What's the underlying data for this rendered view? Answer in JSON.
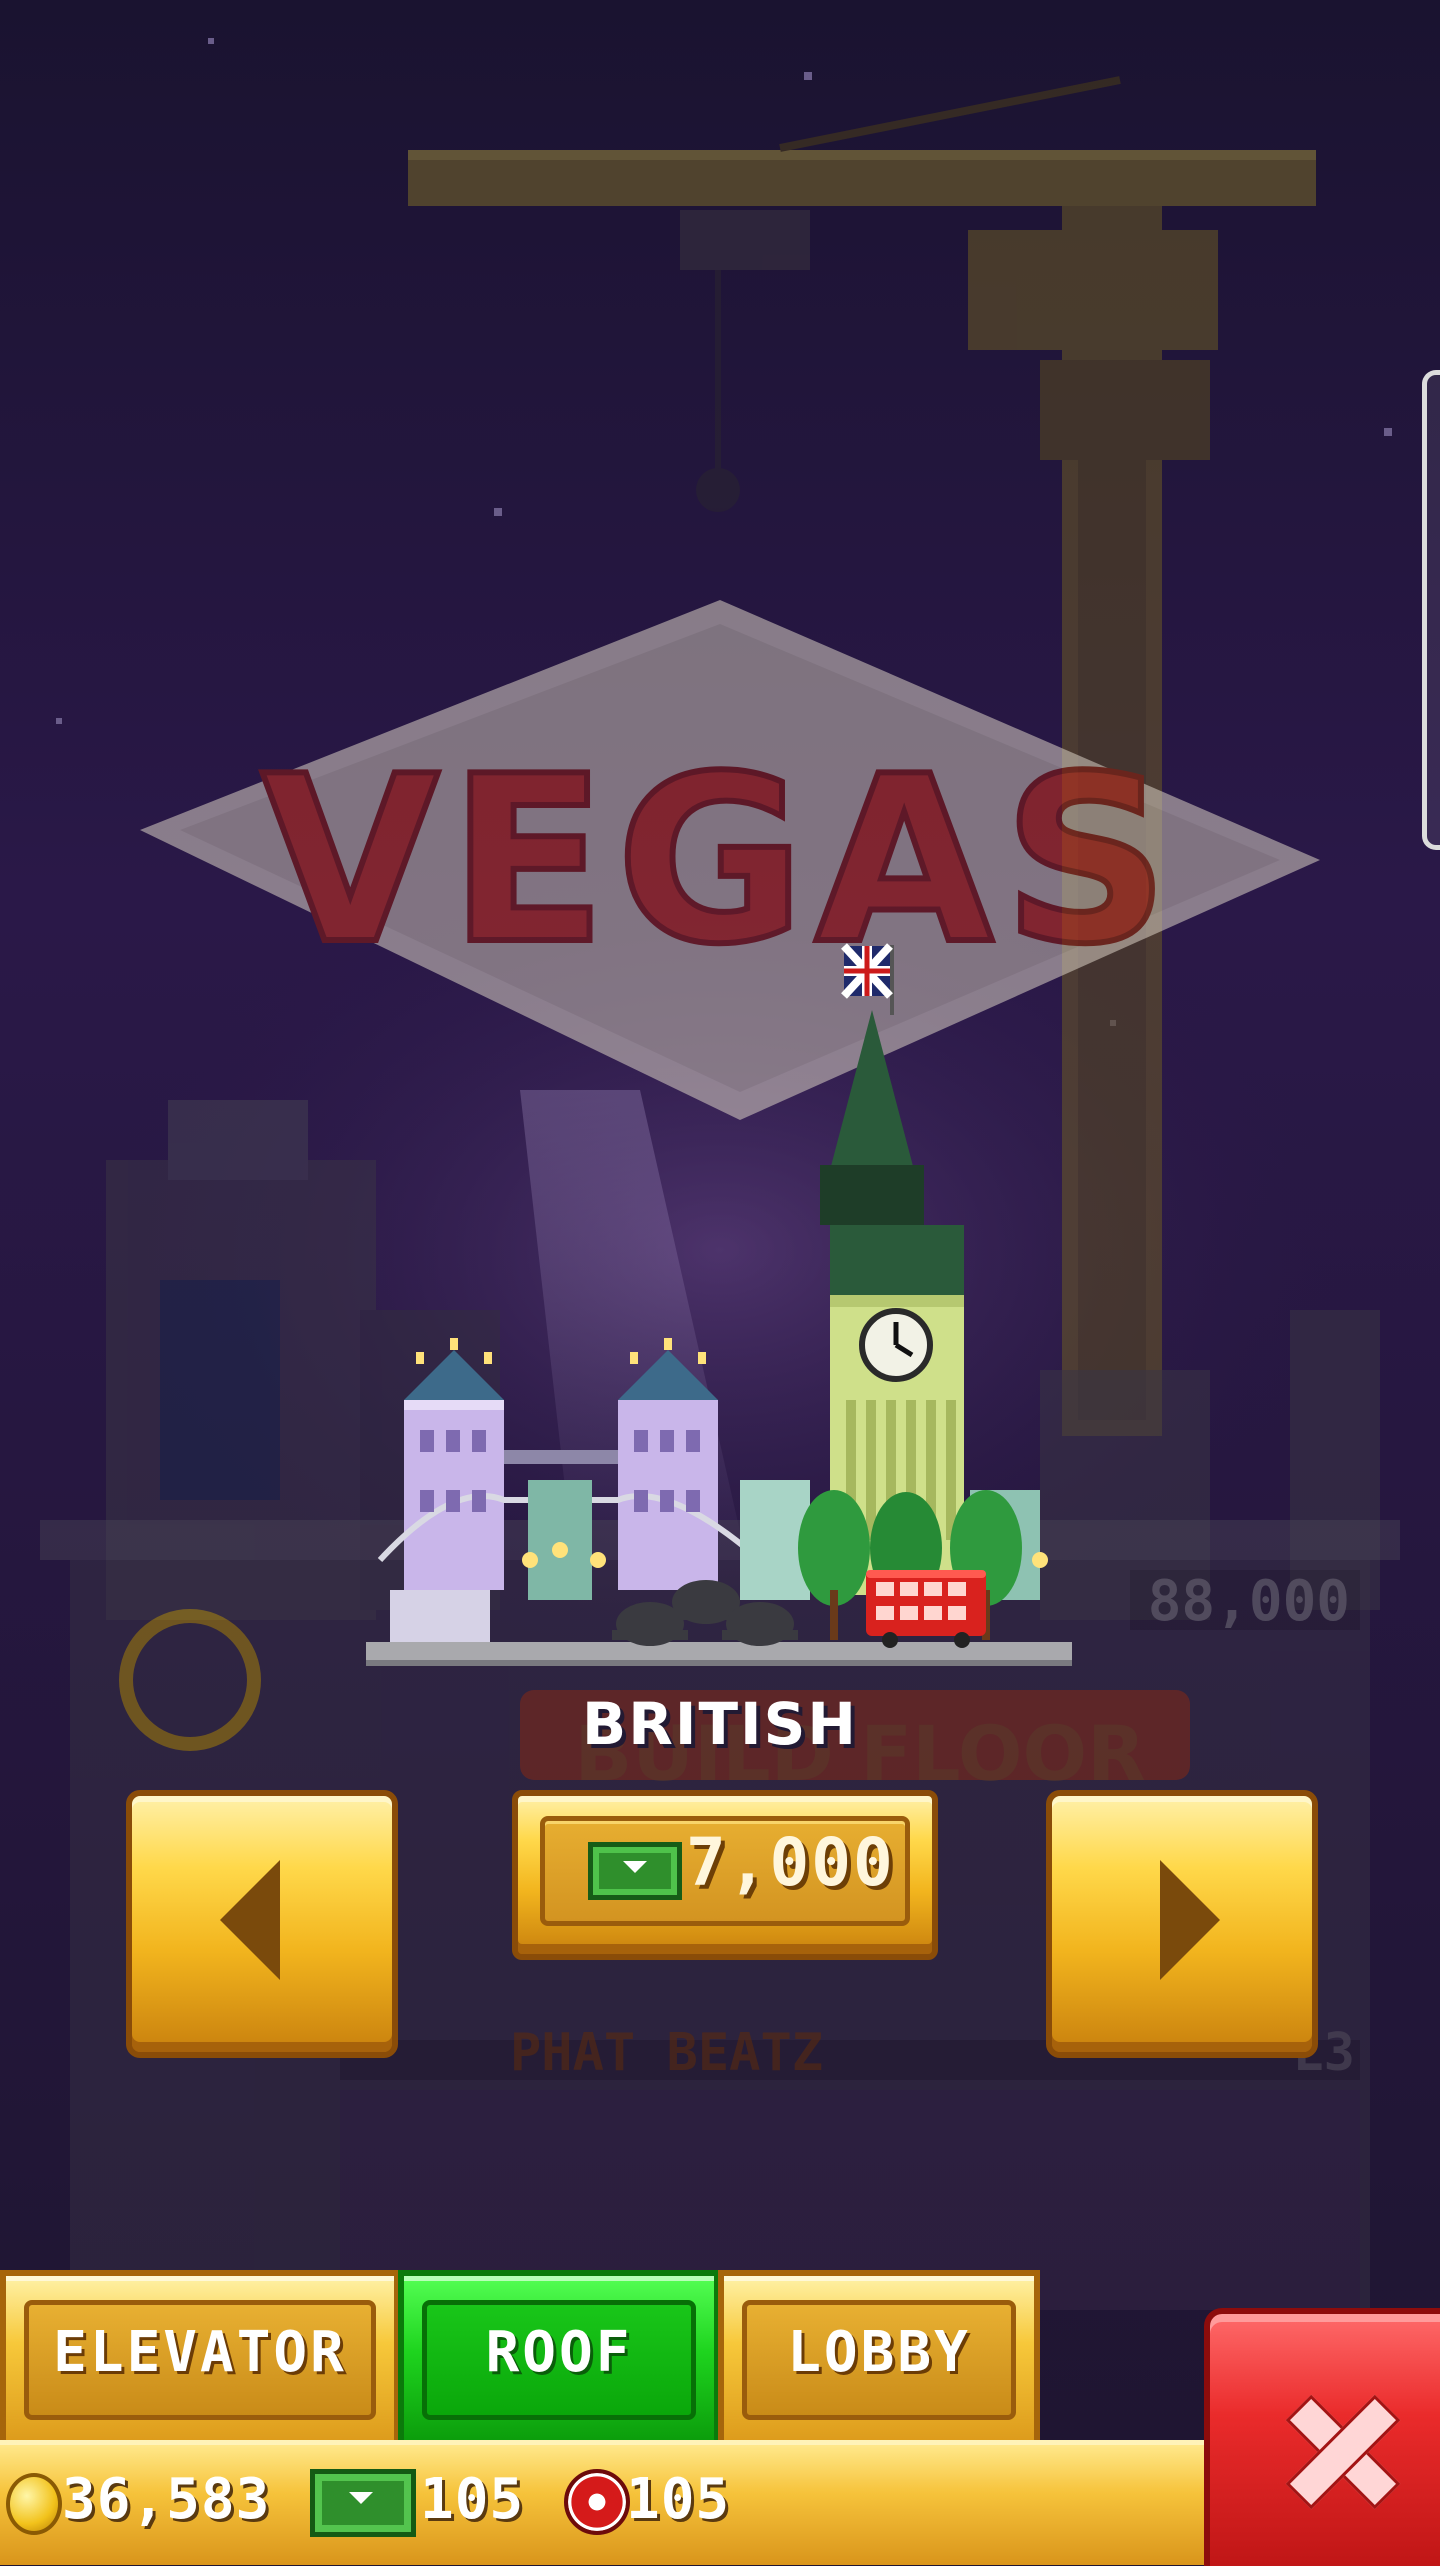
{
  "background_sign": {
    "text": "VEGAS",
    "color": "#c8301e"
  },
  "behind_overlay_text": {
    "build_floor": "BUILD FLOOR",
    "floor_price": "88,000",
    "floor_name": "PHAT BEATZ",
    "floor_level": "L3"
  },
  "roof_selector": {
    "roof_name": "BRITISH",
    "price": "7,000",
    "price_icon": "tower-bux-icon",
    "prev_icon": "arrow-left-icon",
    "next_icon": "arrow-right-icon"
  },
  "tabs": [
    {
      "label": "ELEVATOR",
      "active": false
    },
    {
      "label": "ROOF",
      "active": true
    },
    {
      "label": "LOBBY",
      "active": false
    }
  ],
  "stats": {
    "coins": "36,583",
    "bux": "105",
    "chips": "105",
    "coin_icon": "coin-icon",
    "bux_icon": "tower-bux-icon",
    "chip_icon": "casino-chip-icon"
  },
  "close_icon": "close-icon",
  "colors": {
    "accent_gold": "#f2b51e",
    "active_tab_green": "#1ed41e",
    "close_red": "#ea2b2b"
  }
}
